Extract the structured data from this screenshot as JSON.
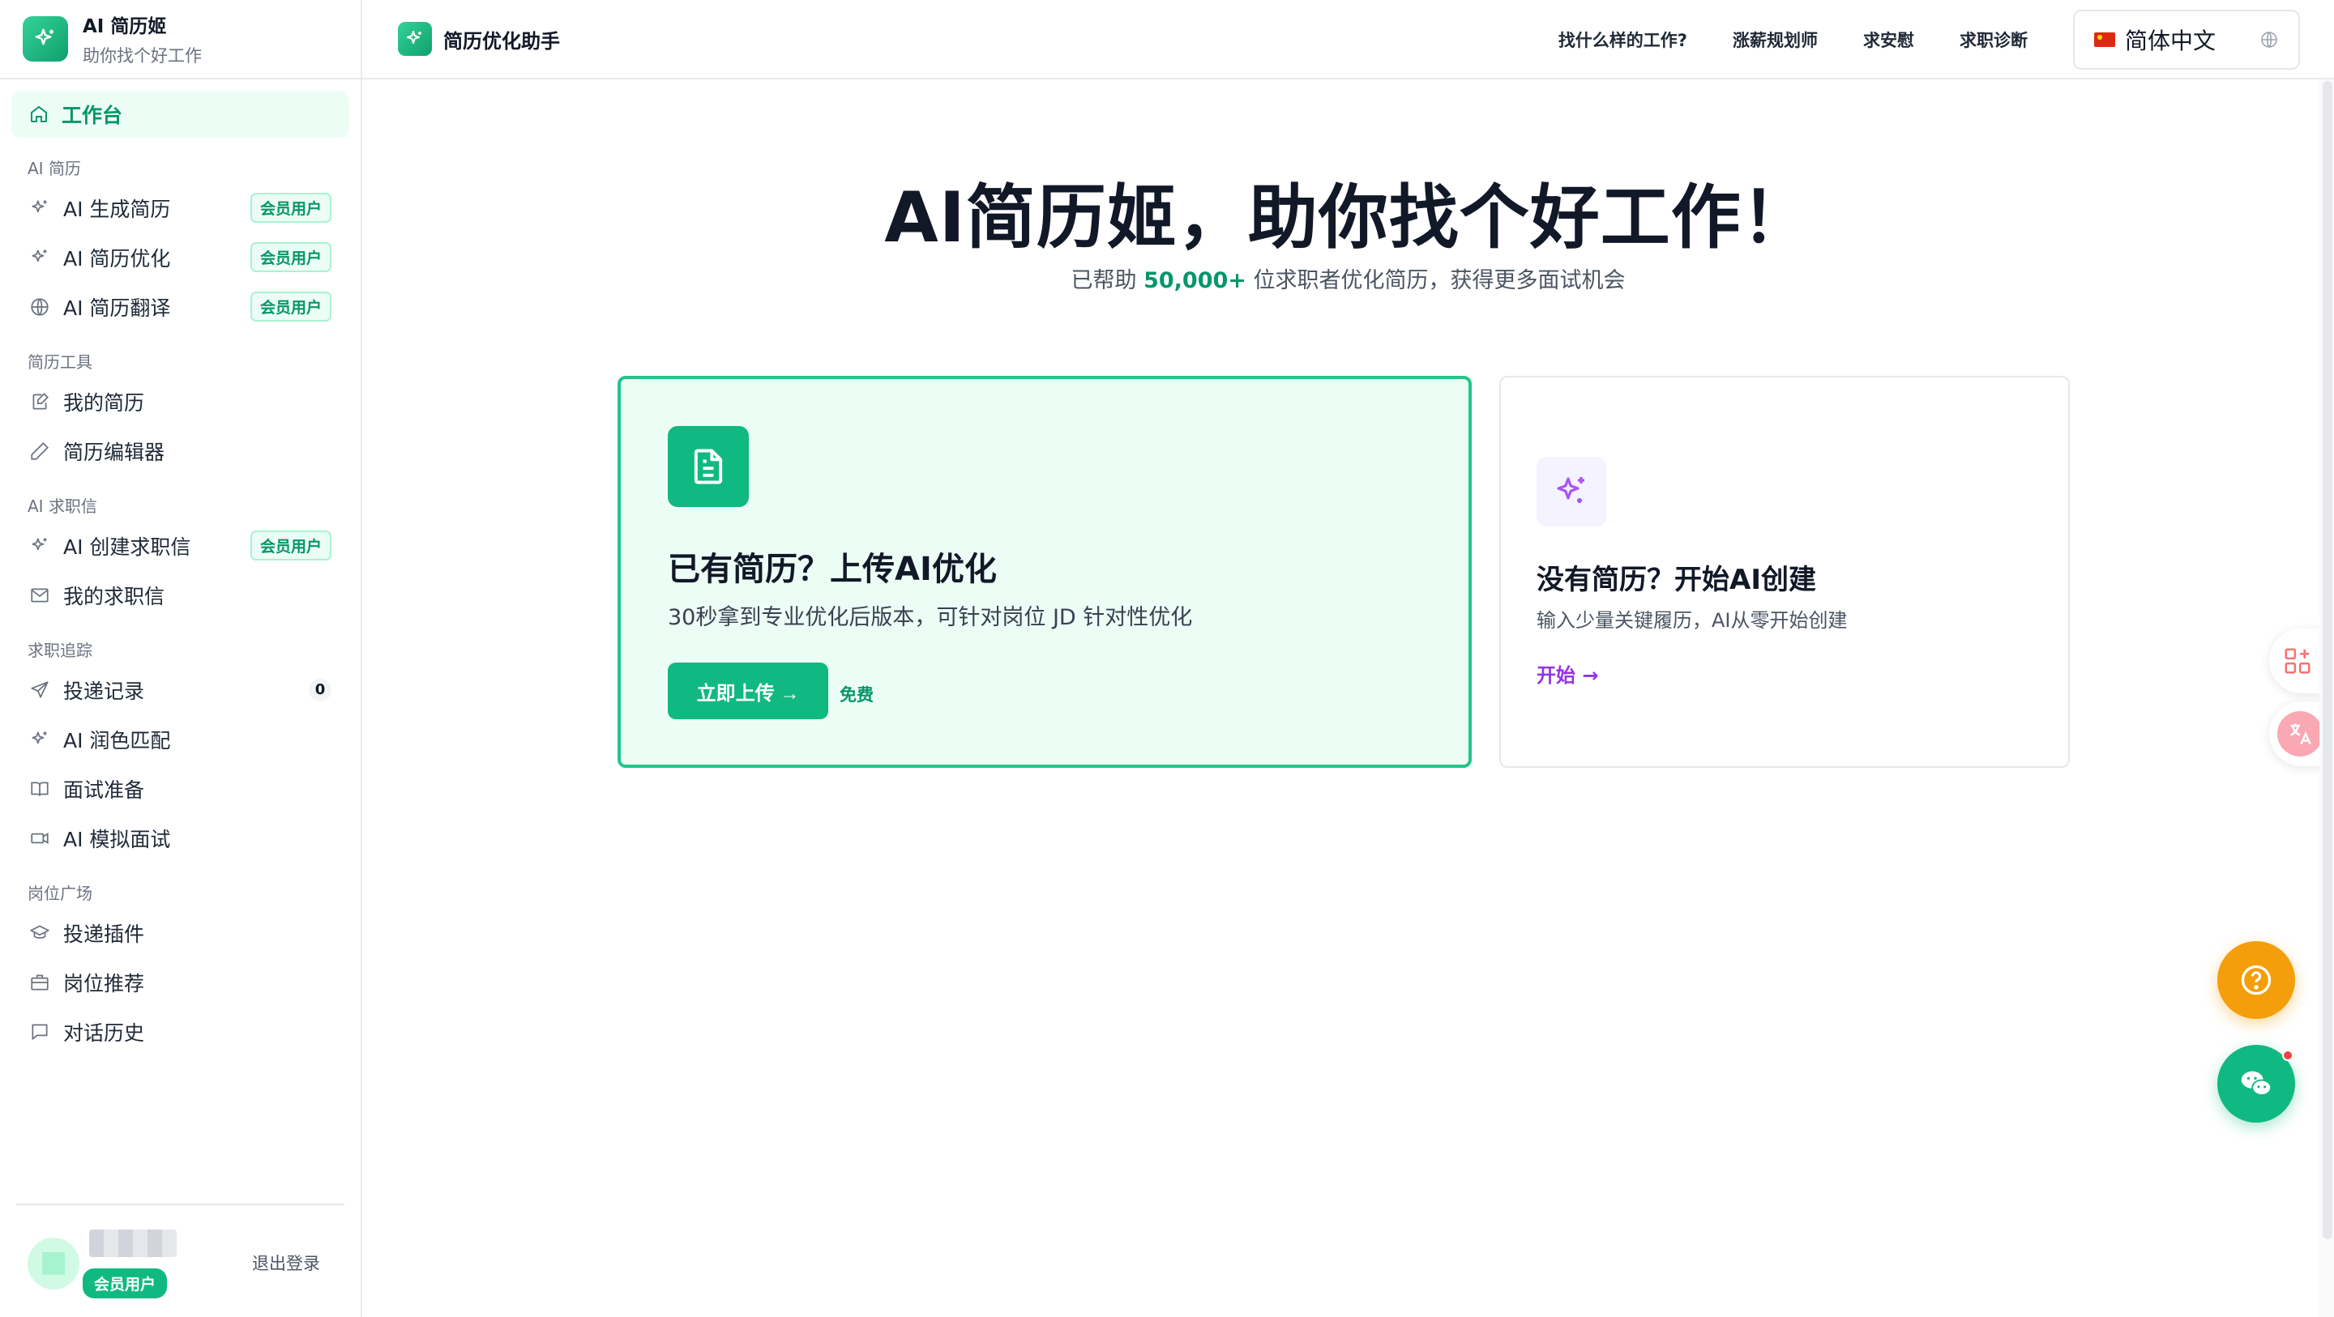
{
  "brand": {
    "title": "AI 简历姬",
    "subtitle": "助你找个好工作"
  },
  "sidebar": {
    "active": "工作台",
    "groups": [
      {
        "label": "AI 简历",
        "items": [
          {
            "label": "AI 生成简历",
            "badge": "会员用户",
            "icon": "sparkle-icon"
          },
          {
            "label": "AI 简历优化",
            "badge": "会员用户",
            "icon": "sparkle-icon"
          },
          {
            "label": "AI 简历翻译",
            "badge": "会员用户",
            "icon": "globe-icon"
          }
        ]
      },
      {
        "label": "简历工具",
        "items": [
          {
            "label": "我的简历",
            "icon": "edit-doc-icon"
          },
          {
            "label": "简历编辑器",
            "icon": "pencil-icon"
          }
        ]
      },
      {
        "label": "AI 求职信",
        "items": [
          {
            "label": "AI 创建求职信",
            "badge": "会员用户",
            "icon": "sparkle-icon"
          },
          {
            "label": "我的求职信",
            "icon": "mail-icon"
          }
        ]
      },
      {
        "label": "求职追踪",
        "items": [
          {
            "label": "投递记录",
            "count": "0",
            "icon": "send-icon"
          },
          {
            "label": "AI 润色匹配",
            "icon": "sparkle-icon"
          },
          {
            "label": "面试准备",
            "icon": "book-icon"
          },
          {
            "label": "AI 模拟面试",
            "icon": "video-icon"
          }
        ]
      },
      {
        "label": "岗位广场",
        "items": [
          {
            "label": "投递插件",
            "icon": "graduation-cap-icon"
          },
          {
            "label": "岗位推荐",
            "icon": "briefcase-icon"
          },
          {
            "label": "对话历史",
            "icon": "chat-icon"
          }
        ]
      }
    ],
    "footer": {
      "member_label": "会员用户",
      "logout_label": "退出登录"
    }
  },
  "header": {
    "title": "简历优化助手",
    "links": [
      "找什么样的工作?",
      "涨薪规划师",
      "求安慰",
      "求职诊断"
    ],
    "language": "简体中文"
  },
  "hero": {
    "title": "AI简历姬，助你找个好工作！",
    "subtitle_prefix": "已帮助 ",
    "subtitle_highlight": "50,000+",
    "subtitle_suffix": " 位求职者优化简历，获得更多面试机会"
  },
  "card_upload": {
    "title": "已有简历？上传AI优化",
    "description": "30秒拿到专业优化后版本，可针对岗位 JD 针对性优化",
    "button_label": "立即上传 →",
    "free_label": "免费"
  },
  "card_create": {
    "title": "没有简历？开始AI创建",
    "description": "输入少量关键履历，AI从零开始创建",
    "link_label": "开始 →"
  },
  "colors": {
    "accent": "#10b981",
    "purple": "#9333ea",
    "help": "#f59e0b"
  }
}
